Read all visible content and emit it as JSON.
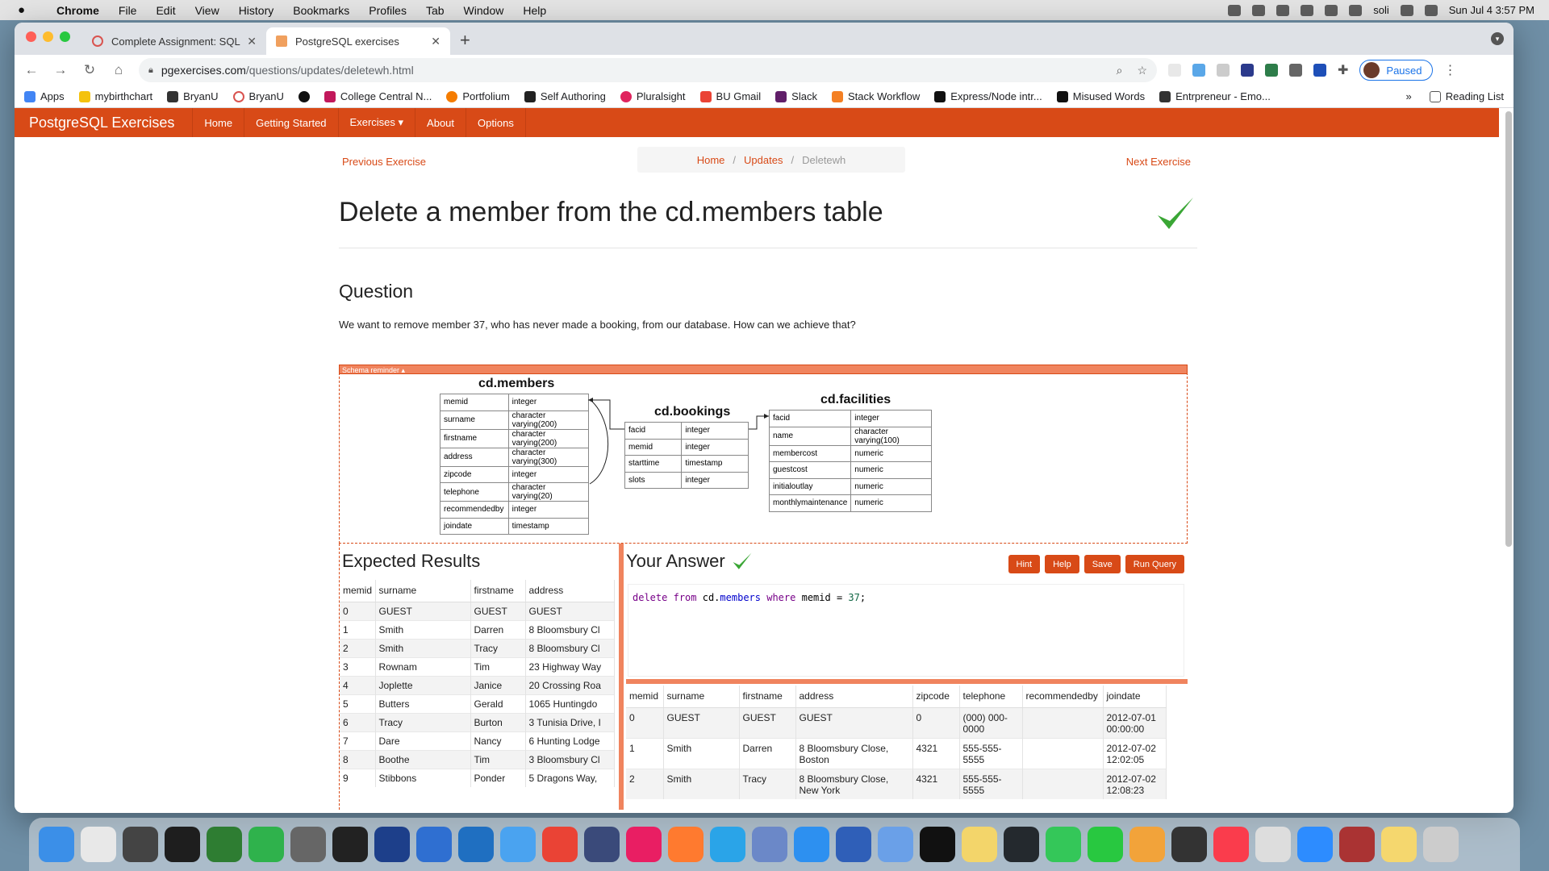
{
  "menubar": {
    "app": "Chrome",
    "items": [
      "File",
      "Edit",
      "View",
      "History",
      "Bookmarks",
      "Profiles",
      "Tab",
      "Window",
      "Help"
    ],
    "user": "soli",
    "clock": "Sun Jul 4  3:57 PM"
  },
  "browser": {
    "tabs": [
      {
        "title": "Complete Assignment: SQL Pr",
        "active": false
      },
      {
        "title": "PostgreSQL exercises",
        "active": true
      }
    ],
    "url_host": "pgexercises.com",
    "url_path": "/questions/updates/deletewh.html",
    "profile_status": "Paused",
    "bookmarks": [
      "Apps",
      "mybirthchart",
      "BryanU",
      "BryanU",
      "",
      "College Central N...",
      "Portfolium",
      "Self Authoring",
      "Pluralsight",
      "BU Gmail",
      "Slack",
      "Stack Workflow",
      "Express/Node intr...",
      "Misused Words",
      "Entrpreneur - Emo..."
    ],
    "overflow": "»",
    "reading_list": "Reading List"
  },
  "site": {
    "brand": "PostgreSQL Exercises",
    "nav": [
      "Home",
      "Getting Started",
      "Exercises ▾",
      "About",
      "Options"
    ],
    "prev": "Previous Exercise",
    "next": "Next Exercise",
    "breadcrumb": {
      "home": "Home",
      "section": "Updates",
      "current": "Deletewh"
    },
    "title": "Delete a member from the cd.members table",
    "question_heading": "Question",
    "question_text": "We want to remove member 37, who has never made a booking, from our database. How can we achieve that?",
    "schema_label": "Schema reminder ▴"
  },
  "schema": {
    "members": {
      "title": "cd.members",
      "rows": [
        [
          "memid",
          "integer"
        ],
        [
          "surname",
          "character varying(200)"
        ],
        [
          "firstname",
          "character varying(200)"
        ],
        [
          "address",
          "character varying(300)"
        ],
        [
          "zipcode",
          "integer"
        ],
        [
          "telephone",
          "character varying(20)"
        ],
        [
          "recommendedby",
          "integer"
        ],
        [
          "joindate",
          "timestamp"
        ]
      ]
    },
    "bookings": {
      "title": "cd.bookings",
      "rows": [
        [
          "facid",
          "integer"
        ],
        [
          "memid",
          "integer"
        ],
        [
          "starttime",
          "timestamp"
        ],
        [
          "slots",
          "integer"
        ]
      ]
    },
    "facilities": {
      "title": "cd.facilities",
      "rows": [
        [
          "facid",
          "integer"
        ],
        [
          "name",
          "character varying(100)"
        ],
        [
          "membercost",
          "numeric"
        ],
        [
          "guestcost",
          "numeric"
        ],
        [
          "initialoutlay",
          "numeric"
        ],
        [
          "monthlymaintenance",
          "numeric"
        ]
      ]
    }
  },
  "expected": {
    "heading": "Expected Results",
    "columns": [
      "memid",
      "surname",
      "firstname",
      "address"
    ],
    "rows": [
      [
        "0",
        "GUEST",
        "GUEST",
        "GUEST"
      ],
      [
        "1",
        "Smith",
        "Darren",
        "8 Bloomsbury Cl"
      ],
      [
        "2",
        "Smith",
        "Tracy",
        "8 Bloomsbury Cl"
      ],
      [
        "3",
        "Rownam",
        "Tim",
        "23 Highway Way"
      ],
      [
        "4",
        "Joplette",
        "Janice",
        "20 Crossing Roa"
      ],
      [
        "5",
        "Butters",
        "Gerald",
        "1065 Huntingdo"
      ],
      [
        "6",
        "Tracy",
        "Burton",
        "3 Tunisia Drive, I"
      ],
      [
        "7",
        "Dare",
        "Nancy",
        "6 Hunting Lodge"
      ],
      [
        "8",
        "Boothe",
        "Tim",
        "3 Bloomsbury Cl"
      ],
      [
        "9",
        "Stibbons",
        "Ponder",
        "5 Dragons Way,"
      ]
    ]
  },
  "answer": {
    "heading": "Your Answer",
    "buttons": [
      "Hint",
      "Help",
      "Save",
      "Run Query"
    ],
    "sql": {
      "kw1": "delete",
      "kw2": "from",
      "schema": "cd.",
      "table": "members",
      "kw3": "where",
      "col": "memid",
      "op": "=",
      "val": "37",
      "end": ";"
    },
    "columns": [
      "memid",
      "surname",
      "firstname",
      "address",
      "zipcode",
      "telephone",
      "recommendedby",
      "joindate"
    ],
    "rows": [
      [
        "0",
        "GUEST",
        "GUEST",
        "GUEST",
        "0",
        "(000) 000-\n0000",
        "",
        "2012-07-01\n00:00:00"
      ],
      [
        "1",
        "Smith",
        "Darren",
        "8 Bloomsbury Close,\nBoston",
        "4321",
        "555-555-\n5555",
        "",
        "2012-07-02\n12:02:05"
      ],
      [
        "2",
        "Smith",
        "Tracy",
        "8 Bloomsbury Close,\nNew York",
        "4321",
        "555-555-\n5555",
        "",
        "2012-07-02\n12:08:23"
      ]
    ]
  },
  "colors": {
    "accent": "#d84a17",
    "accent_light": "#f0845e",
    "check": "#3aa635"
  }
}
